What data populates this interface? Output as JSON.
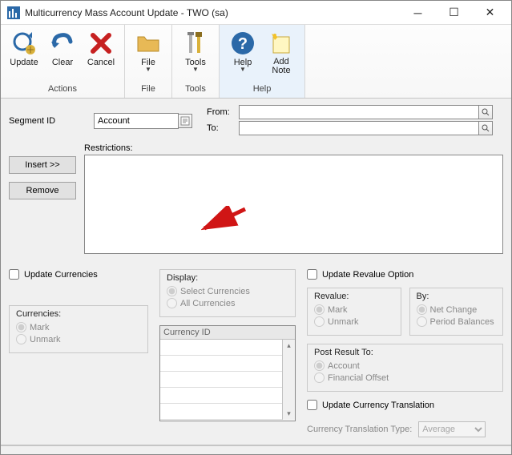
{
  "window": {
    "title": "Multicurrency Mass Account Update  -  TWO (sa)"
  },
  "ribbon": {
    "update": "Update",
    "clear": "Clear",
    "cancel": "Cancel",
    "file": "File",
    "tools": "Tools",
    "help": "Help",
    "addnote": "Add Note",
    "group_actions": "Actions",
    "group_file": "File",
    "group_tools": "Tools",
    "group_help": "Help"
  },
  "segment": {
    "label": "Segment ID",
    "value": "Account",
    "from_label": "From:",
    "from_value": "",
    "to_label": "To:",
    "to_value": ""
  },
  "restrictions": {
    "label": "Restrictions:",
    "insert": "Insert >>",
    "remove": "Remove",
    "value": ""
  },
  "options": {
    "update_currencies": "Update Currencies",
    "display_label": "Display:",
    "display_select": "Select Currencies",
    "display_all": "All Currencies",
    "currencies_label": "Currencies:",
    "mark": "Mark",
    "unmark": "Unmark",
    "currency_id": "Currency ID",
    "update_revalue": "Update Revalue Option",
    "revalue_label": "Revalue:",
    "by_label": "By:",
    "net_change": "Net Change",
    "period_balances": "Period Balances",
    "post_result": "Post Result To:",
    "account": "Account",
    "financial_offset": "Financial Offset",
    "update_translation": "Update Currency Translation",
    "translation_type_label": "Currency Translation Type:",
    "translation_type_value": "Average"
  }
}
